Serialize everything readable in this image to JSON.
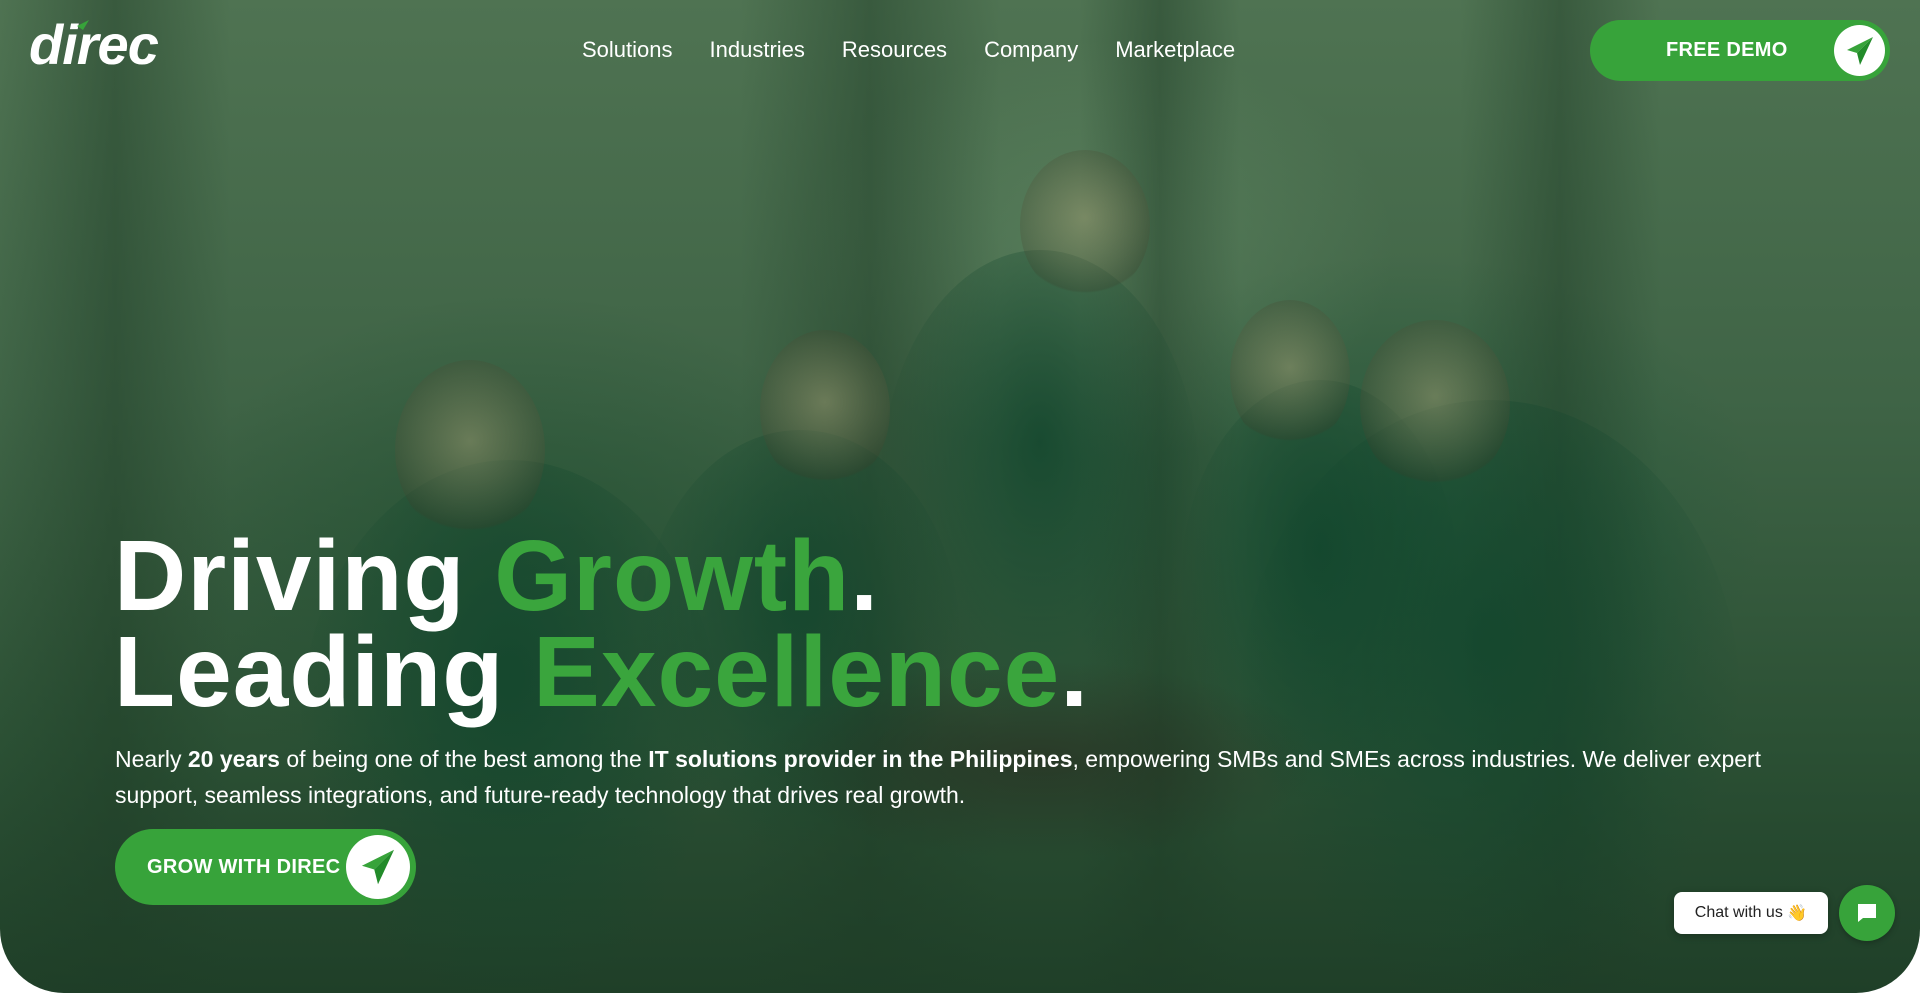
{
  "header": {
    "logo_text": "direc",
    "nav": [
      "Solutions",
      "Industries",
      "Resources",
      "Company",
      "Marketplace"
    ],
    "cta_label": "FREE DEMO"
  },
  "hero": {
    "line1_white": "Driving ",
    "line1_green": "Growth",
    "line1_end": ".",
    "line2_white": "Leading ",
    "line2_green": "Excellence",
    "line2_end": ".",
    "sub_1": "Nearly ",
    "sub_2_bold": "20 years",
    "sub_3": " of being one of the best among the ",
    "sub_4_bold": "IT solutions provider in the Philippines",
    "sub_5": ", empowering SMBs and SMEs across industries. We deliver expert support, seamless integrations, and future-ready technology that drives real growth.",
    "cta_label": "GROW WITH DIREC"
  },
  "chat": {
    "label": "Chat with us",
    "emoji": "👋"
  },
  "colors": {
    "brand_green": "#37a33a",
    "overlay": "#2f5538",
    "white": "#ffffff"
  },
  "icons": [
    "paper-plane-icon",
    "chat-icon"
  ]
}
